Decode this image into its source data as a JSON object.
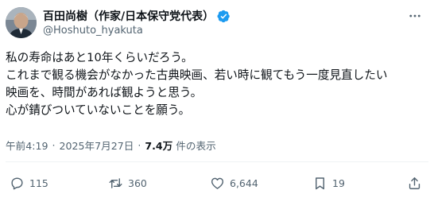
{
  "author": {
    "display_name": "百田尚樹（作家/日本保守党代表）",
    "handle": "@Hoshuto_hyakuta",
    "verified": true
  },
  "post": {
    "lines": [
      "私の寿命はあと10年くらいだろう。",
      "これまで観る機会がなかった古典映画、若い時に観てもう一度見直したい",
      "映画を、時間があれば観ようと思う。",
      "心が錆びついていないことを願う。"
    ],
    "time": "午前4:19",
    "date": "2025年7月27日",
    "views_count": "7.4万",
    "views_label": "件の表示"
  },
  "actions": {
    "replies": "115",
    "reposts": "360",
    "likes": "6,644",
    "bookmarks": "19"
  },
  "colors": {
    "verified": "#1d9bf0",
    "secondary_text": "#536471",
    "primary_text": "#0f1419"
  },
  "icons": [
    "more-icon",
    "verified-badge-icon",
    "reply-icon",
    "repost-icon",
    "like-icon",
    "bookmark-icon",
    "share-icon"
  ]
}
